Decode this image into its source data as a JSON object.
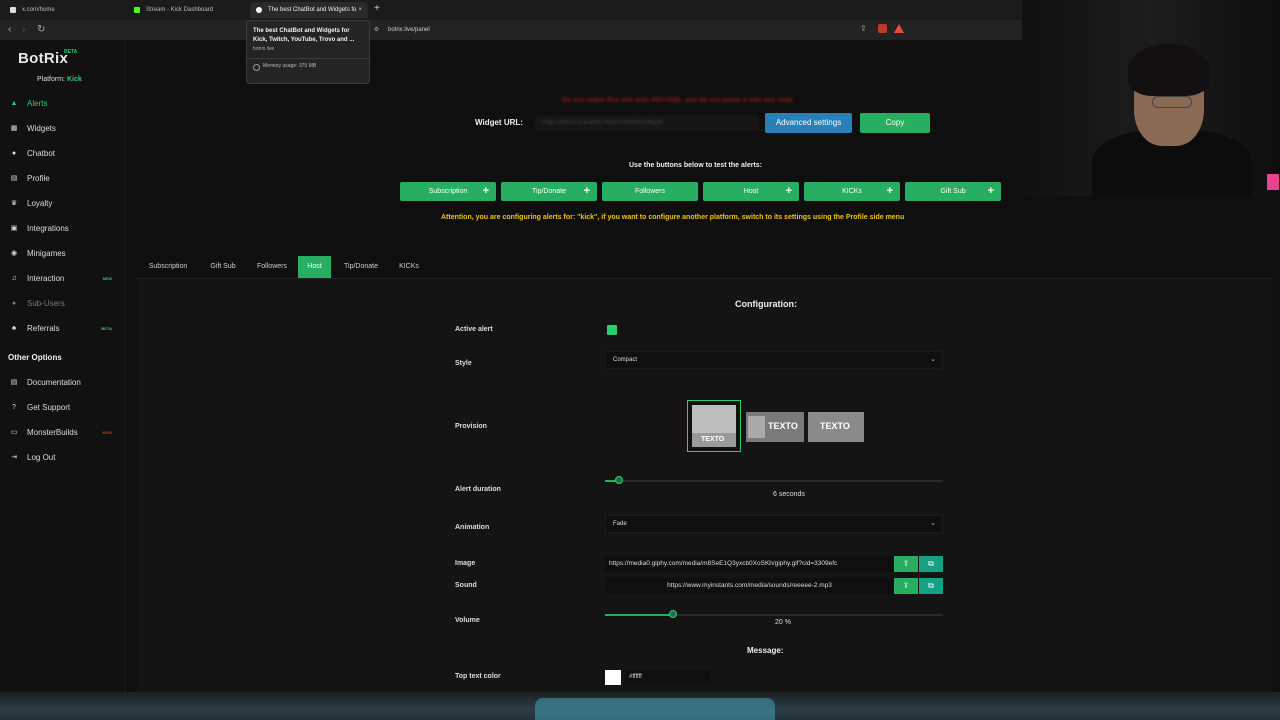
{
  "browser": {
    "tabs": [
      {
        "title": "x.com/home"
      },
      {
        "title": "Stream - Kick Dashboard"
      },
      {
        "title": "The best ChatBot and Widgets fo"
      }
    ],
    "address": "botrix.live/panel",
    "tooltip": {
      "title": "The best ChatBot and Widgets for Kick, Twitch, YouTube, Trovo and ...",
      "domain": "botrix.live",
      "memory": "Memory usage: 375 MB"
    }
  },
  "sidebar": {
    "logo": "BotRix",
    "beta": "BETA",
    "platform_label": "Platform:",
    "platform_value": "Kick",
    "items": [
      {
        "label": "Alerts",
        "icon": "bell-icon"
      },
      {
        "label": "Widgets",
        "icon": "widgets-icon"
      },
      {
        "label": "Chatbot",
        "icon": "chat-icon"
      },
      {
        "label": "Profile",
        "icon": "profile-icon"
      },
      {
        "label": "Loyalty",
        "icon": "trophy-icon"
      },
      {
        "label": "Integrations",
        "icon": "integrations-icon"
      },
      {
        "label": "Minigames",
        "icon": "gamepad-icon"
      },
      {
        "label": "Interaction",
        "icon": "music-icon",
        "badge": "NEW"
      },
      {
        "label": "Sub-Users",
        "icon": "users-icon"
      },
      {
        "label": "Referrals",
        "icon": "referrals-icon",
        "badge": "BETA"
      }
    ],
    "other_options": "Other Options",
    "other_items": [
      {
        "label": "Documentation",
        "icon": "document-icon"
      },
      {
        "label": "Get Support",
        "icon": "support-icon"
      },
      {
        "label": "MonsterBuilds",
        "icon": "monitor-icon",
        "badge": "NEW"
      },
      {
        "label": "Log Out",
        "icon": "logout-icon"
      }
    ]
  },
  "main": {
    "warning": "Do not share this link with ANYONE, and do not paste it into any chat.",
    "widget_url_label": "Widget URL:",
    "widget_url_value": "https://botrix.live/alerts?bid=CvxNFtFt0dBg4h",
    "advanced_settings": "Advanced settings",
    "copy": "Copy",
    "test_title": "Use the buttons below to test the alerts:",
    "test_buttons": [
      "Subscription",
      "Tip/Donate",
      "Followers",
      "Host",
      "KICKs",
      "Gift Sub"
    ],
    "attention": "Attention, you are configuring alerts for: \"kick\", if you want to configure another platform, switch to its settings using the Profile side menu",
    "tabs": [
      "Subscription",
      "Gift Sub",
      "Followers",
      "Host",
      "Tip/Donate",
      "KICKs"
    ],
    "active_tab": "Host",
    "config": {
      "title": "Configuration:",
      "active_alert_label": "Active alert",
      "active_alert_checked": true,
      "style_label": "Style",
      "style_value": "Compact",
      "provision_label": "Provision",
      "provision_option_text": "TEXTO",
      "alert_duration_label": "Alert duration",
      "alert_duration_value": "6",
      "alert_duration_unit": "seconds",
      "alert_duration_fraction": 0.04,
      "animation_label": "Animation",
      "animation_value": "Fade",
      "image_label": "Image",
      "image_value": "https://media0.giphy.com/media/m8SeE1Q3yxcb0XoSKh/giphy.gif?cid=3309efc",
      "sound_label": "Sound",
      "sound_value": "https://www.myinstants.com/media/sounds/reeeee-2.mp3",
      "volume_label": "Volume",
      "volume_value": "20",
      "volume_unit": "%",
      "volume_fraction": 0.2,
      "message_title": "Message:",
      "top_text_color_label": "Top text color",
      "top_text_color_value": "#ffffff"
    }
  },
  "colors": {
    "accent_green": "#27ae60",
    "accent_blue": "#2980b9",
    "attention_yellow": "#f1c40f",
    "warning_red": "#8b1a1a"
  }
}
